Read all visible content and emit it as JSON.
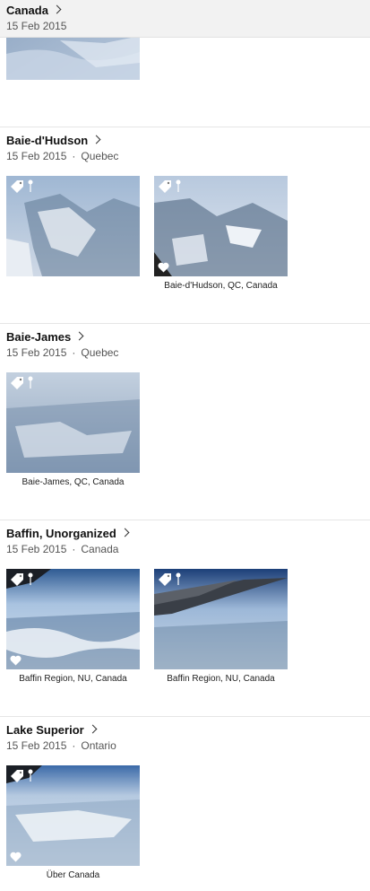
{
  "header": {
    "title": "Canada",
    "date": "15 Feb 2015"
  },
  "sections": [
    {
      "title": "Baie-d'Hudson",
      "date": "15 Feb 2015",
      "region": "Quebec",
      "photos": [
        {
          "caption": "",
          "favorite": false
        },
        {
          "caption": "Baie-d'Hudson, QC, Canada",
          "favorite": true
        }
      ]
    },
    {
      "title": "Baie-James",
      "date": "15 Feb 2015",
      "region": "Quebec",
      "photos": [
        {
          "caption": "Baie-James, QC, Canada",
          "favorite": false
        }
      ]
    },
    {
      "title": "Baffin, Unorganized",
      "date": "15 Feb 2015",
      "region": "Canada",
      "photos": [
        {
          "caption": "Baffin Region, NU, Canada",
          "favorite": true
        },
        {
          "caption": "Baffin Region, NU, Canada",
          "favorite": false
        }
      ]
    },
    {
      "title": "Lake Superior",
      "date": "15 Feb 2015",
      "region": "Ontario",
      "photos": [
        {
          "caption": "Über Canada",
          "favorite": true
        }
      ]
    }
  ],
  "separator": "·",
  "icons": {
    "tag": "tag-icon",
    "pin": "location-pin-icon",
    "heart": "heart-icon",
    "chevron": "chevron-right-icon"
  }
}
